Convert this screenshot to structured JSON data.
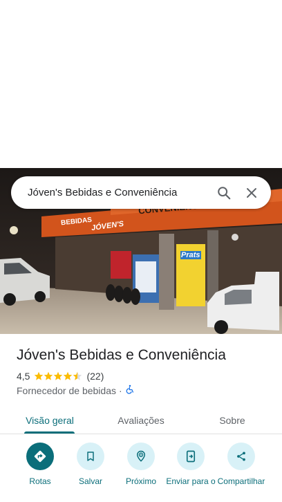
{
  "search": {
    "query": "Jóven's Bebidas e Conveniência"
  },
  "place": {
    "name": "Jóven's Bebidas e Conveniência",
    "rating": "4,5",
    "rating_value": 4.5,
    "reviews_count": "(22)",
    "category": "Fornecedor de bebidas",
    "separator": "·"
  },
  "photo": {
    "signs": [
      "BEBIDAS",
      "JÓVEN'S",
      "CONVENIÊNCIA",
      "Prats"
    ]
  },
  "tabs": [
    {
      "label": "Visão geral",
      "active": true
    },
    {
      "label": "Avaliações",
      "active": false
    },
    {
      "label": "Sobre",
      "active": false
    }
  ],
  "actions": [
    {
      "label": "Rotas",
      "icon": "directions-icon"
    },
    {
      "label": "Salvar",
      "icon": "bookmark-icon"
    },
    {
      "label": "Próximo",
      "icon": "nearby-icon"
    },
    {
      "label": "Enviar para o",
      "icon": "send-to-phone-icon"
    },
    {
      "label": "Compartilhar",
      "icon": "share-icon"
    }
  ],
  "colors": {
    "accent": "#0b6e7a",
    "action_bg": "#d8f1f7",
    "star": "#fbbc04",
    "accessibility": "#1a73e8"
  }
}
